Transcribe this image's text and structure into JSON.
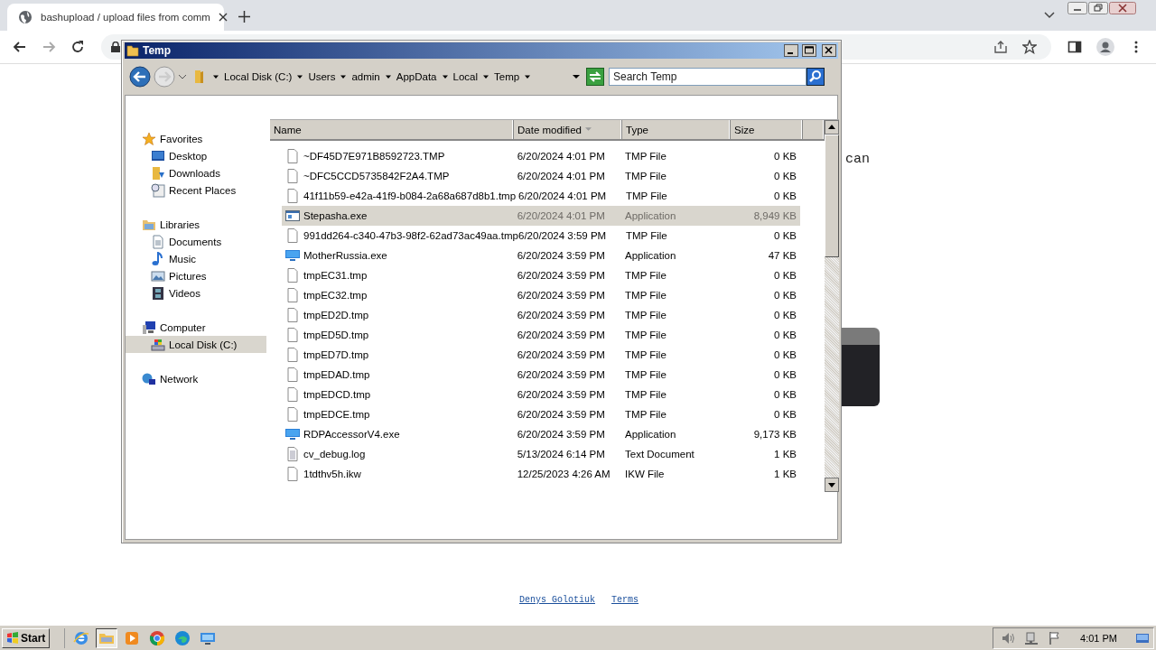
{
  "browser": {
    "tab_title": "bashupload / upload files from comm",
    "page_text": "can",
    "footer_links": [
      "Denys Golotiuk",
      "Terms"
    ]
  },
  "explorer": {
    "title": "Temp",
    "breadcrumb": [
      "Local Disk (C:)",
      "Users",
      "admin",
      "AppData",
      "Local",
      "Temp"
    ],
    "search": {
      "placeholder": "Search Temp"
    },
    "nav": [
      {
        "label": "Favorites",
        "kind": "star",
        "children": [
          {
            "label": "Desktop",
            "kind": "desktop",
            "selected": false
          },
          {
            "label": "Downloads",
            "kind": "downloads",
            "selected": false
          },
          {
            "label": "Recent Places",
            "kind": "recent",
            "selected": false
          }
        ]
      },
      {
        "label": "Libraries",
        "kind": "libraries",
        "children": [
          {
            "label": "Documents",
            "kind": "documents",
            "selected": false
          },
          {
            "label": "Music",
            "kind": "music",
            "selected": false
          },
          {
            "label": "Pictures",
            "kind": "pictures",
            "selected": false
          },
          {
            "label": "Videos",
            "kind": "videos",
            "selected": false
          }
        ]
      },
      {
        "label": "Computer",
        "kind": "computer",
        "children": [
          {
            "label": "Local Disk (C:)",
            "kind": "disk",
            "selected": true
          }
        ]
      },
      {
        "label": "Network",
        "kind": "network"
      }
    ],
    "columns": [
      {
        "label": "Name",
        "sorted": false
      },
      {
        "label": "Date modified",
        "sorted": true
      },
      {
        "label": "Type",
        "sorted": false
      },
      {
        "label": "Size",
        "sorted": false
      }
    ],
    "rows": [
      {
        "name": "~DF45D7E971B8592723.TMP",
        "date": "6/20/2024 4:01 PM",
        "type": "TMP File",
        "size": "0 KB",
        "kind": "file",
        "selected": false
      },
      {
        "name": "~DFC5CCD5735842F2A4.TMP",
        "date": "6/20/2024 4:01 PM",
        "type": "TMP File",
        "size": "0 KB",
        "kind": "file",
        "selected": false
      },
      {
        "name": "41f11b59-e42a-41f9-b084-2a68a687d8b1.tmp",
        "date": "6/20/2024 4:01 PM",
        "type": "TMP File",
        "size": "0 KB",
        "kind": "file",
        "selected": false
      },
      {
        "name": "Stepasha.exe",
        "date": "6/20/2024 4:01 PM",
        "type": "Application",
        "size": "8,949 KB",
        "kind": "app",
        "selected": true
      },
      {
        "name": "991dd264-c340-47b3-98f2-62ad73ac49aa.tmp",
        "date": "6/20/2024 3:59 PM",
        "type": "TMP File",
        "size": "0 KB",
        "kind": "file",
        "selected": false
      },
      {
        "name": "MotherRussia.exe",
        "date": "6/20/2024 3:59 PM",
        "type": "Application",
        "size": "47 KB",
        "kind": "monitor",
        "selected": false
      },
      {
        "name": "tmpEC31.tmp",
        "date": "6/20/2024 3:59 PM",
        "type": "TMP File",
        "size": "0 KB",
        "kind": "file",
        "selected": false
      },
      {
        "name": "tmpEC32.tmp",
        "date": "6/20/2024 3:59 PM",
        "type": "TMP File",
        "size": "0 KB",
        "kind": "file",
        "selected": false
      },
      {
        "name": "tmpED2D.tmp",
        "date": "6/20/2024 3:59 PM",
        "type": "TMP File",
        "size": "0 KB",
        "kind": "file",
        "selected": false
      },
      {
        "name": "tmpED5D.tmp",
        "date": "6/20/2024 3:59 PM",
        "type": "TMP File",
        "size": "0 KB",
        "kind": "file",
        "selected": false
      },
      {
        "name": "tmpED7D.tmp",
        "date": "6/20/2024 3:59 PM",
        "type": "TMP File",
        "size": "0 KB",
        "kind": "file",
        "selected": false
      },
      {
        "name": "tmpEDAD.tmp",
        "date": "6/20/2024 3:59 PM",
        "type": "TMP File",
        "size": "0 KB",
        "kind": "file",
        "selected": false
      },
      {
        "name": "tmpEDCD.tmp",
        "date": "6/20/2024 3:59 PM",
        "type": "TMP File",
        "size": "0 KB",
        "kind": "file",
        "selected": false
      },
      {
        "name": "tmpEDCE.tmp",
        "date": "6/20/2024 3:59 PM",
        "type": "TMP File",
        "size": "0 KB",
        "kind": "file",
        "selected": false
      },
      {
        "name": "RDPAccessorV4.exe",
        "date": "6/20/2024 3:59 PM",
        "type": "Application",
        "size": "9,173 KB",
        "kind": "monitor",
        "selected": false
      },
      {
        "name": "cv_debug.log",
        "date": "5/13/2024 6:14 PM",
        "type": "Text Document",
        "size": "1 KB",
        "kind": "text",
        "selected": false
      },
      {
        "name": "1tdthv5h.ikw",
        "date": "12/25/2023 4:26 AM",
        "type": "IKW File",
        "size": "1 KB",
        "kind": "file",
        "selected": false
      }
    ]
  },
  "taskbar": {
    "start": "Start",
    "apps": [
      {
        "kind": "ie",
        "selected": false
      },
      {
        "kind": "explorer",
        "selected": true
      },
      {
        "kind": "media",
        "selected": false
      },
      {
        "kind": "chrome",
        "selected": false
      },
      {
        "kind": "edge",
        "selected": false
      },
      {
        "kind": "monitor",
        "selected": false
      }
    ],
    "clock": "4:01 PM"
  }
}
